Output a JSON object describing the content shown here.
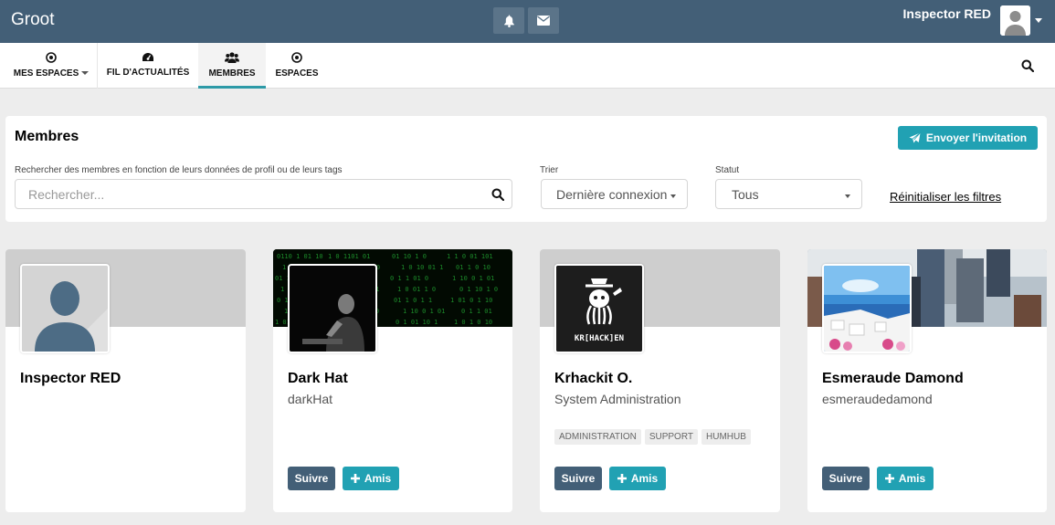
{
  "app": {
    "brand": "Groot"
  },
  "topbar": {
    "user_name": "Inspector RED",
    "icons": [
      "bell-icon",
      "envelope-icon"
    ]
  },
  "nav": {
    "items": [
      {
        "label": "MES ESPACES",
        "icon": "dot-circle-icon",
        "has_caret": true
      },
      {
        "label": "FIL D'ACTUALITÉS",
        "icon": "dashboard-icon"
      },
      {
        "label": "MEMBRES",
        "icon": "users-icon",
        "active": true
      },
      {
        "label": "ESPACES",
        "icon": "dot-circle-icon"
      }
    ]
  },
  "panel": {
    "title": "Membres",
    "invite_label": "Envoyer l'invitation",
    "search_label": "Rechercher des membres en fonction de leurs données de profil ou de leurs tags",
    "search_placeholder": "Rechercher...",
    "sort_label": "Trier",
    "sort_value": "Dernière connexion",
    "status_label": "Statut",
    "status_value": "Tous",
    "reset_label": "Réinitialiser les filtres"
  },
  "cards": [
    {
      "name": "Inspector RED",
      "info": "",
      "tags": [],
      "follow": "",
      "friend": ""
    },
    {
      "name": "Dark Hat",
      "info": "darkHat",
      "tags": [],
      "follow": "Suivre",
      "friend": "Amis"
    },
    {
      "name": "Krhackit O.",
      "info": "System Administration",
      "tags": [
        "ADMINISTRATION",
        "SUPPORT",
        "HUMHUB"
      ],
      "follow": "Suivre",
      "friend": "Amis"
    },
    {
      "name": "Esmeraude Damond",
      "info": "esmeraudedamond",
      "tags": [],
      "follow": "Suivre",
      "friend": "Amis"
    }
  ],
  "avatar_logo_text": "KR[HACK]EN",
  "colors": {
    "topbar": "#435f77",
    "accent": "#21a1b3",
    "follow": "#435f77"
  }
}
